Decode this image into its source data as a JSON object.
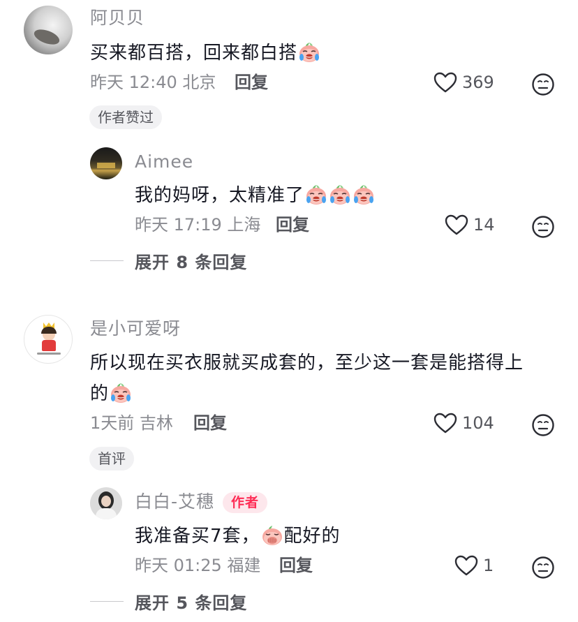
{
  "comments": [
    {
      "user": "阿贝贝",
      "text": "买来都百搭，回来都白搭",
      "emoji": "crying-laugh-peach-emoji",
      "time": "昨天 12:40 北京",
      "reply_label": "回复",
      "likes": "369",
      "badge": "作者赞过",
      "replies": [
        {
          "user": "Aimee",
          "text": "我的妈呀，太精准了",
          "emoji": "crying-laugh-peach-emoji",
          "emoji_count": 3,
          "time": "昨天 17:19 上海",
          "reply_label": "回复",
          "likes": "14"
        }
      ],
      "expand_label": "展开 8 条回复"
    },
    {
      "user": "是小可爱呀",
      "text_line1": "所以现在买衣服就买成套的，至少这一套是能搭得上",
      "text_line2": "的",
      "emoji": "crying-laugh-peach-emoji",
      "time": "1天前 吉林",
      "reply_label": "回复",
      "likes": "104",
      "badge": "首评",
      "replies": [
        {
          "user": "白白-艾穗",
          "author_tag": "作者",
          "text_before": "我准备买7套，",
          "emoji": "covering-mouth-peach-emoji",
          "text_after": "配好的",
          "time": "昨天 01:25 福建",
          "reply_label": "回复",
          "likes": "1"
        }
      ],
      "expand_label": "展开 5 条回复"
    }
  ],
  "colors": {
    "primary_text": "#161823",
    "secondary_text": "#8a8b91",
    "author_tag_bg": "#fde7ec",
    "author_tag_text": "#fe2c55",
    "badge_bg": "#f1f1f3"
  }
}
